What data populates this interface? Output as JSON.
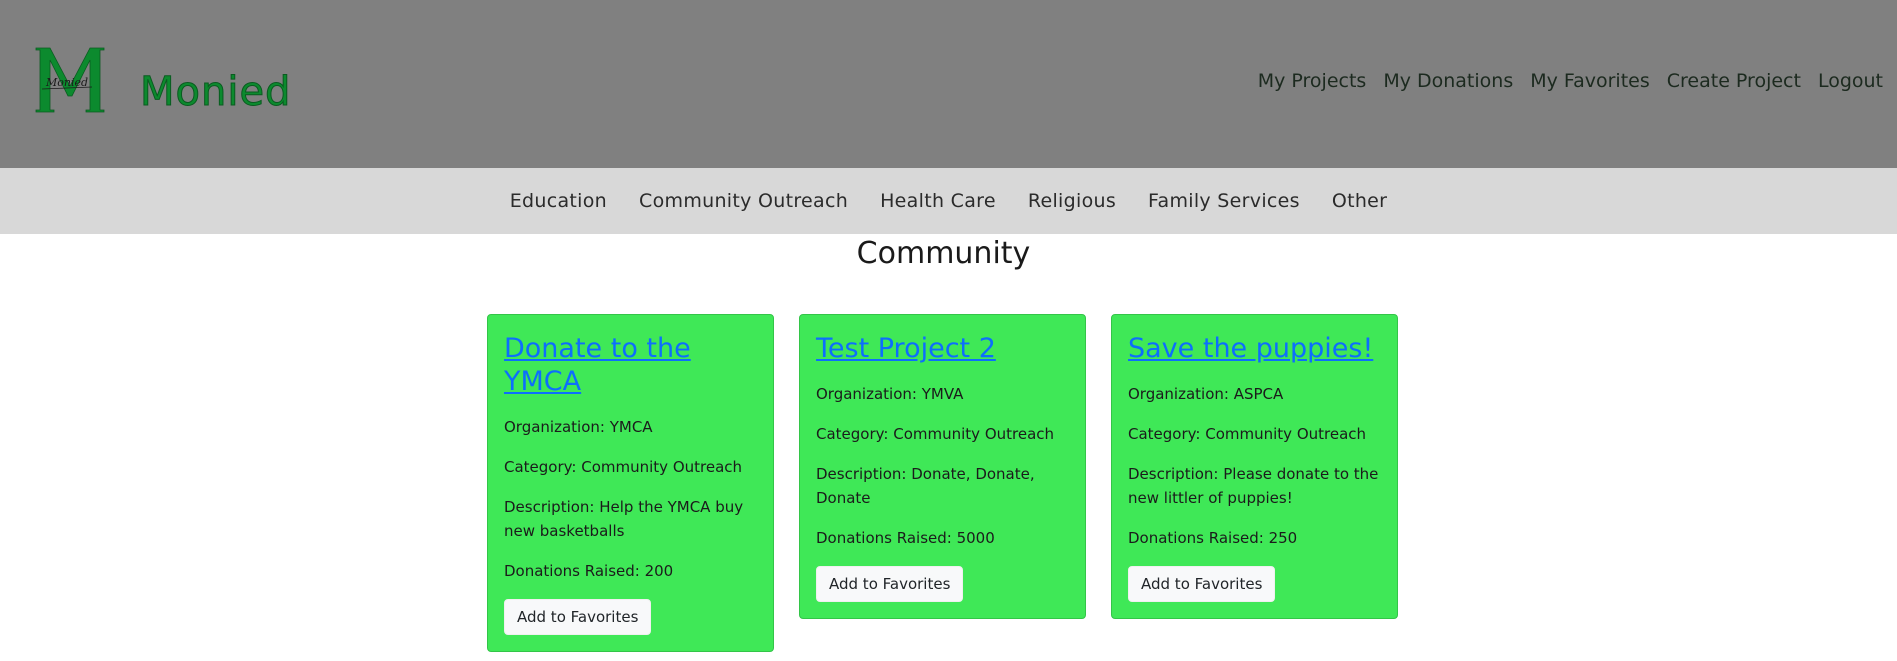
{
  "brand": {
    "logo_letter": "M",
    "logo_script": "Monied",
    "name": "Monied"
  },
  "top_nav": [
    {
      "label": "My Projects"
    },
    {
      "label": "My Donations"
    },
    {
      "label": "My Favorites"
    },
    {
      "label": "Create Project"
    },
    {
      "label": "Logout"
    }
  ],
  "categories": [
    {
      "label": "Education"
    },
    {
      "label": "Community Outreach"
    },
    {
      "label": "Health Care"
    },
    {
      "label": "Religious"
    },
    {
      "label": "Family Services"
    },
    {
      "label": "Other"
    }
  ],
  "page": {
    "title": "Community"
  },
  "cards": [
    {
      "title": "Donate to the YMCA",
      "organization": "Organization: YMCA",
      "category": "Category: Community Outreach",
      "description": "Description: Help the YMCA buy new basketballs",
      "donations": "Donations Raised: 200",
      "button": "Add to Favorites"
    },
    {
      "title": "Test Project 2",
      "organization": "Organization: YMVA",
      "category": "Category: Community Outreach",
      "description": "Description: Donate, Donate, Donate",
      "donations": "Donations Raised: 5000",
      "button": "Add to Favorites"
    },
    {
      "title": "Save the puppies!",
      "organization": "Organization: ASPCA",
      "category": "Category: Community Outreach",
      "description": "Description: Please donate to the new littler of puppies!",
      "donations": "Donations Raised: 250",
      "button": "Add to Favorites"
    }
  ],
  "colors": {
    "header_bg": "#808080",
    "category_bar_bg": "#d8d8d8",
    "card_bg": "#3fe857",
    "brand_green": "#0c8a2e",
    "link_blue": "#0d6efd"
  }
}
